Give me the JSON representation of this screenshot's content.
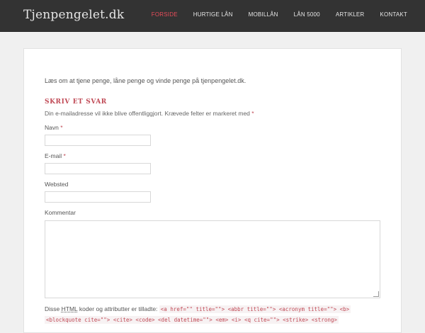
{
  "header": {
    "brand": "Tjenpengelet.dk",
    "nav": [
      {
        "label": "FORSIDE",
        "active": true
      },
      {
        "label": "HURTIGE LÅN",
        "active": false
      },
      {
        "label": "MOBILLÅN",
        "active": false
      },
      {
        "label": "LÅN 5000",
        "active": false
      },
      {
        "label": "ARTIKLER",
        "active": false
      },
      {
        "label": "KONTAKT",
        "active": false
      }
    ]
  },
  "main": {
    "intro": "Læs om at tjene penge, låne penge og vinde penge på tjenpengelet.dk.",
    "reply_title": "SKRIV ET SVAR",
    "notes_text": "Din e-mailadresse vil ikke blive offentliggjort. Krævede felter er markeret med",
    "required_mark": "*",
    "fields": {
      "name_label": "Navn",
      "email_label": "E-mail",
      "website_label": "Websted",
      "comment_label": "Kommentar"
    },
    "allowed_prefix": "Disse",
    "allowed_abbr": "HTML",
    "allowed_suffix": "koder og attributter er tilladte:",
    "allowed_code_line1": "<a href=\"\" title=\"\"> <abbr title=\"\"> <acronym title=\"\"> <b>",
    "allowed_code_line2": "<blockquote cite=\"\"> <cite> <code> <del datetime=\"\"> <em> <i> <q cite=\"\"> <strike> <strong>"
  },
  "colors": {
    "topbar": "#333333",
    "accent": "#e74c5a",
    "page_bg": "#f0f0f0"
  }
}
